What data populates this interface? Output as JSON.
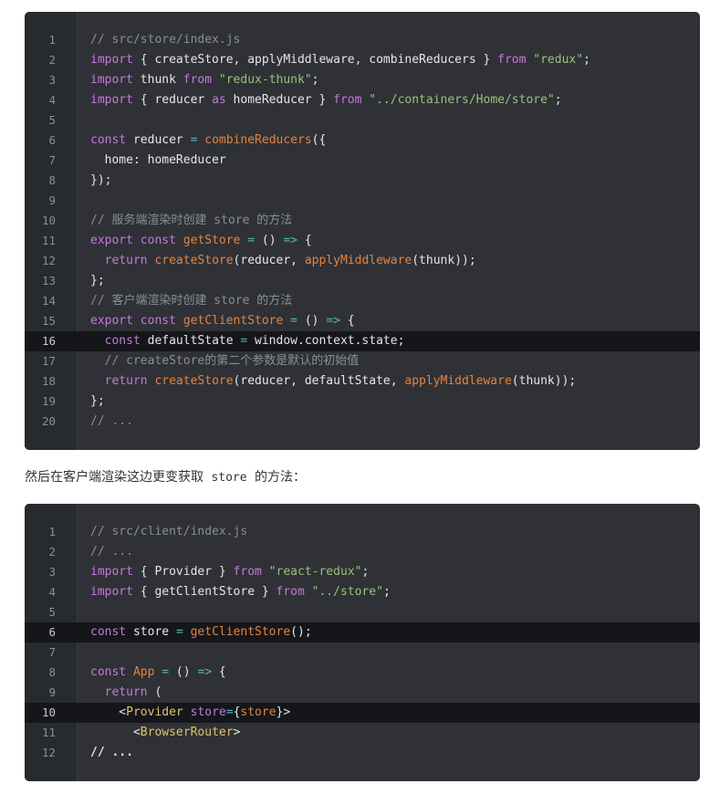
{
  "code_block_1": {
    "highlighted_lines": [
      16
    ],
    "lines": [
      [
        [
          "c",
          "// src/store/index.js"
        ]
      ],
      [
        [
          "k",
          "import"
        ],
        [
          "p",
          " { createStore, applyMiddleware, combineReducers } "
        ],
        [
          "k",
          "from"
        ],
        [
          "p",
          " "
        ],
        [
          "s",
          "\"redux\""
        ],
        [
          "p",
          ";"
        ]
      ],
      [
        [
          "k",
          "import"
        ],
        [
          "p",
          " thunk "
        ],
        [
          "k",
          "from"
        ],
        [
          "p",
          " "
        ],
        [
          "s",
          "\"redux-thunk\""
        ],
        [
          "p",
          ";"
        ]
      ],
      [
        [
          "k",
          "import"
        ],
        [
          "p",
          " { reducer "
        ],
        [
          "k",
          "as"
        ],
        [
          "p",
          " homeReducer } "
        ],
        [
          "k",
          "from"
        ],
        [
          "p",
          " "
        ],
        [
          "s",
          "\"../containers/Home/store\""
        ],
        [
          "p",
          ";"
        ]
      ],
      [],
      [
        [
          "k",
          "const"
        ],
        [
          "p",
          " reducer "
        ],
        [
          "o",
          "="
        ],
        [
          "p",
          " "
        ],
        [
          "f",
          "combineReducers"
        ],
        [
          "p",
          "({"
        ]
      ],
      [
        [
          "p",
          "  home: homeReducer"
        ]
      ],
      [
        [
          "p",
          "});"
        ]
      ],
      [],
      [
        [
          "c",
          "// 服务端渲染时创建 store 的方法"
        ]
      ],
      [
        [
          "k",
          "export"
        ],
        [
          "p",
          " "
        ],
        [
          "k",
          "const"
        ],
        [
          "p",
          " "
        ],
        [
          "f",
          "getStore"
        ],
        [
          "p",
          " "
        ],
        [
          "o",
          "="
        ],
        [
          "p",
          " () "
        ],
        [
          "o",
          "=>"
        ],
        [
          "p",
          " {"
        ]
      ],
      [
        [
          "p",
          "  "
        ],
        [
          "k",
          "return"
        ],
        [
          "p",
          " "
        ],
        [
          "f",
          "createStore"
        ],
        [
          "p",
          "(reducer, "
        ],
        [
          "f",
          "applyMiddleware"
        ],
        [
          "p",
          "(thunk));"
        ]
      ],
      [
        [
          "p",
          "};"
        ]
      ],
      [
        [
          "c",
          "// 客户端渲染时创建 store 的方法"
        ]
      ],
      [
        [
          "k",
          "export"
        ],
        [
          "p",
          " "
        ],
        [
          "k",
          "const"
        ],
        [
          "p",
          " "
        ],
        [
          "f",
          "getClientStore"
        ],
        [
          "p",
          " "
        ],
        [
          "o",
          "="
        ],
        [
          "p",
          " () "
        ],
        [
          "o",
          "=>"
        ],
        [
          "p",
          " {"
        ]
      ],
      [
        [
          "p",
          "  "
        ],
        [
          "k",
          "const"
        ],
        [
          "p",
          " defaultState "
        ],
        [
          "o",
          "="
        ],
        [
          "p",
          " window.context.state;"
        ]
      ],
      [
        [
          "c",
          "  // createStore的第二个参数是默认的初始值"
        ]
      ],
      [
        [
          "p",
          "  "
        ],
        [
          "k",
          "return"
        ],
        [
          "p",
          " "
        ],
        [
          "f",
          "createStore"
        ],
        [
          "p",
          "(reducer, defaultState, "
        ],
        [
          "f",
          "applyMiddleware"
        ],
        [
          "p",
          "(thunk));"
        ]
      ],
      [
        [
          "p",
          "};"
        ]
      ],
      [
        [
          "c",
          "// ..."
        ]
      ]
    ]
  },
  "prose": {
    "before": "然后在客户端渲染这边更变获取 ",
    "code": "store",
    "after": " 的方法："
  },
  "code_block_2": {
    "highlighted_lines": [
      6,
      10
    ],
    "lines": [
      [
        [
          "c",
          "// src/client/index.js"
        ]
      ],
      [
        [
          "c",
          "// ..."
        ]
      ],
      [
        [
          "k",
          "import"
        ],
        [
          "p",
          " { Provider } "
        ],
        [
          "k",
          "from"
        ],
        [
          "p",
          " "
        ],
        [
          "s",
          "\"react-redux\""
        ],
        [
          "p",
          ";"
        ]
      ],
      [
        [
          "k",
          "import"
        ],
        [
          "p",
          " { getClientStore } "
        ],
        [
          "k",
          "from"
        ],
        [
          "p",
          " "
        ],
        [
          "s",
          "\"../store\""
        ],
        [
          "p",
          ";"
        ]
      ],
      [],
      [
        [
          "k",
          "const"
        ],
        [
          "p",
          " store "
        ],
        [
          "o",
          "="
        ],
        [
          "p",
          " "
        ],
        [
          "f",
          "getClientStore"
        ],
        [
          "p",
          "();"
        ]
      ],
      [],
      [
        [
          "k",
          "const"
        ],
        [
          "p",
          " "
        ],
        [
          "f",
          "App"
        ],
        [
          "p",
          " "
        ],
        [
          "o",
          "="
        ],
        [
          "p",
          " () "
        ],
        [
          "o",
          "=>"
        ],
        [
          "p",
          " {"
        ]
      ],
      [
        [
          "p",
          "  "
        ],
        [
          "k",
          "return"
        ],
        [
          "p",
          " ("
        ]
      ],
      [
        [
          "p",
          "    <"
        ],
        [
          "t",
          "Provider"
        ],
        [
          "p",
          " "
        ],
        [
          "k",
          "store"
        ],
        [
          "o",
          "="
        ],
        [
          "p",
          "{"
        ],
        [
          "f",
          "store"
        ],
        [
          "p",
          "}>"
        ]
      ],
      [
        [
          "p",
          "      <"
        ],
        [
          "t",
          "BrowserRouter"
        ],
        [
          "p",
          ">"
        ]
      ],
      [
        [
          "bold",
          "// ..."
        ]
      ]
    ]
  },
  "colors": {
    "block_bg": "#2f3136",
    "gutter_bg": "#272a2e",
    "highlight_bg": "#14161a",
    "comment": "#8a8f97",
    "keyword": "#c678dd",
    "string": "#98c379",
    "function": "#e5833f",
    "operator": "#56b6c2",
    "tag": "#e0c465"
  }
}
